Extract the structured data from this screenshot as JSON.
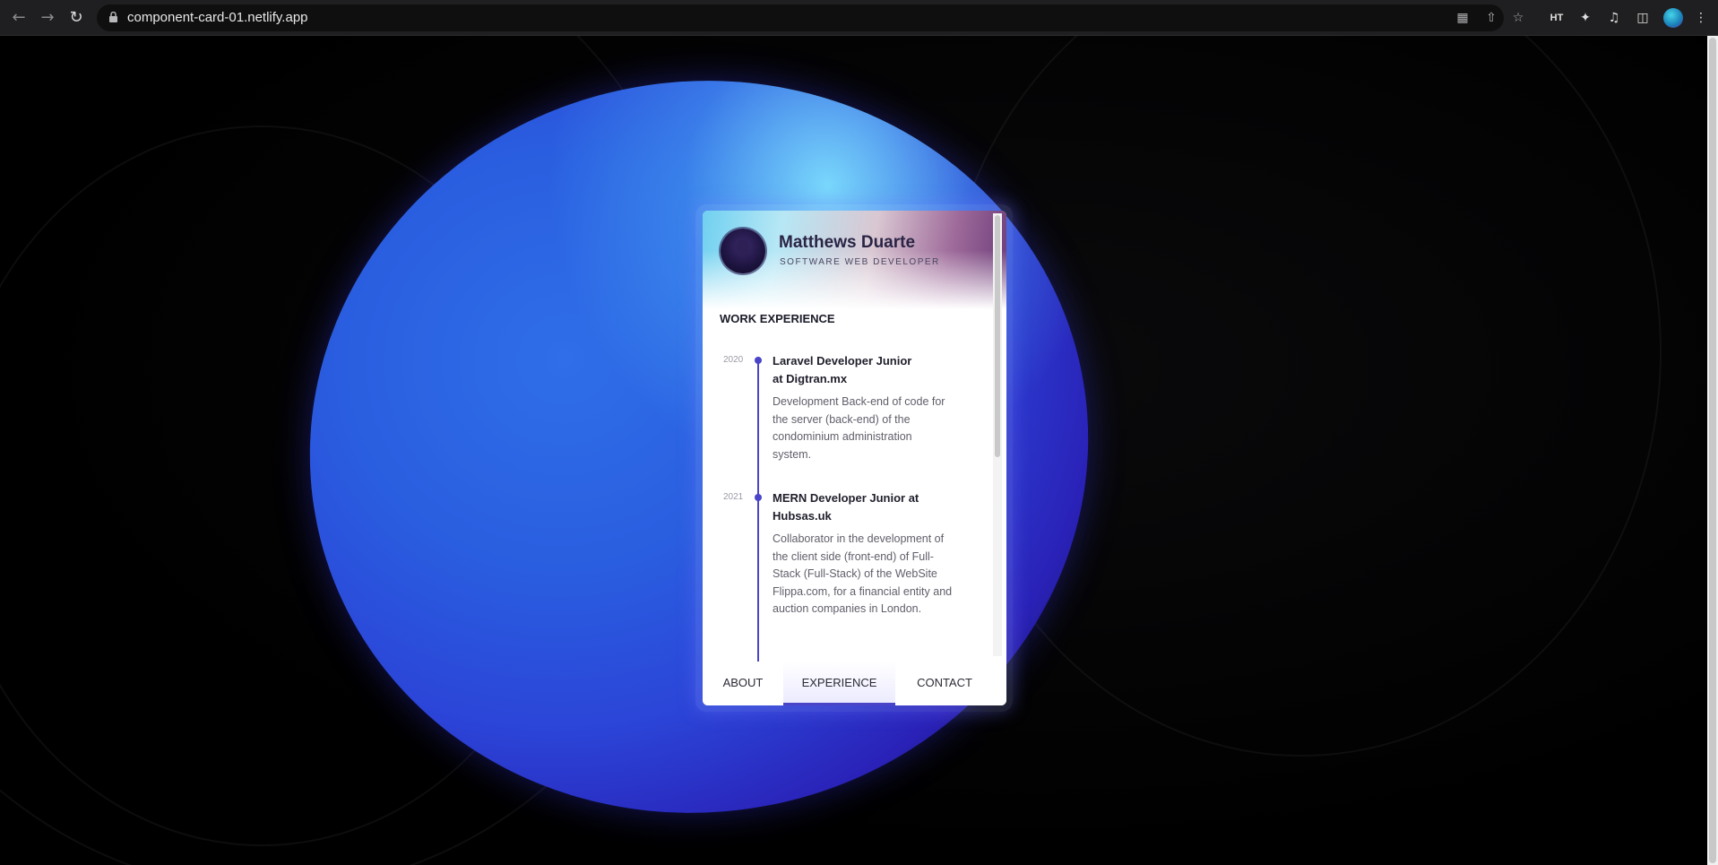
{
  "browser": {
    "url": "component-card-01.netlify.app",
    "back_icon": "arrow-left-icon",
    "forward_icon": "arrow-right-icon",
    "reload_icon": "reload-icon",
    "extension_ht": "HT"
  },
  "profile": {
    "name": "Matthews Duarte",
    "role": "SOFTWARE WEB DEVELOPER"
  },
  "experience": {
    "section_title": "WORK EXPERIENCE",
    "items": [
      {
        "year": "2020",
        "title": "Laravel Developer Junior at Digtran.mx",
        "description": "Development Back-end of code for the server (back-end) of the condominium administration system."
      },
      {
        "year": "2021",
        "title": "MERN Developer Junior at Hubsas.uk",
        "description": "Collaborator in the development of the client side (front-end) of Full-Stack (Full-Stack) of the WebSite Flippa.com, for a financial entity and auction companies in London."
      }
    ]
  },
  "tabs": [
    {
      "label": "ABOUT",
      "active": false
    },
    {
      "label": "EXPERIENCE",
      "active": true
    },
    {
      "label": "CONTACT",
      "active": false
    }
  ],
  "colors": {
    "accent": "#4a45c8",
    "page_background": "#000000",
    "planet": "#2b5fe0"
  }
}
